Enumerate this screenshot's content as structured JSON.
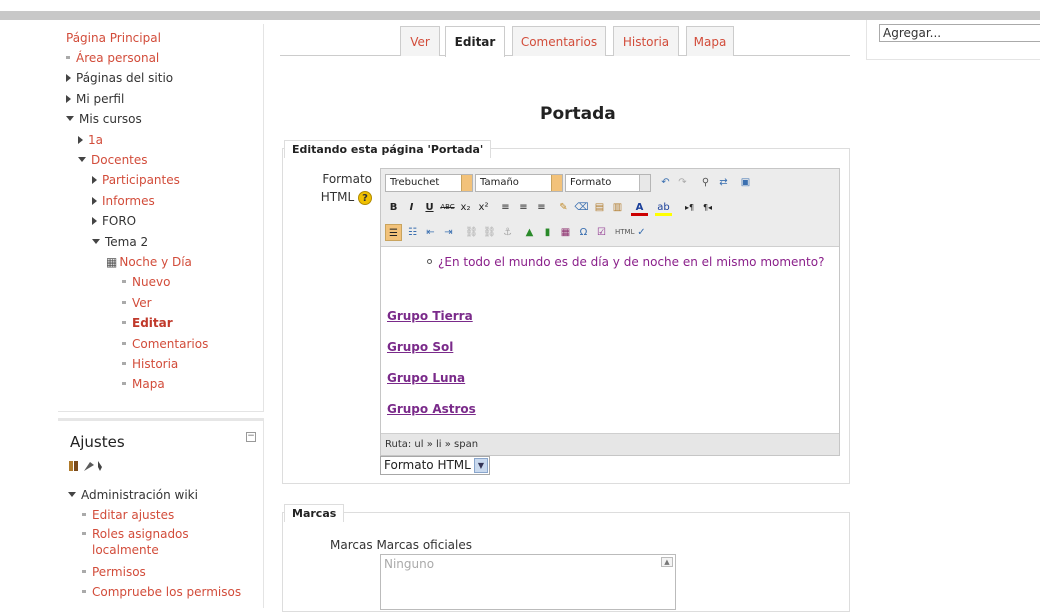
{
  "nav": {
    "home": "Página Principal",
    "items": [
      {
        "label": "Área personal",
        "type": "bullet",
        "indent": 0
      },
      {
        "label": "Páginas del sitio",
        "type": "collapsed",
        "indent": 0
      },
      {
        "label": "Mi perfil",
        "type": "collapsed",
        "indent": 0
      },
      {
        "label": "Mis cursos",
        "type": "expanded",
        "indent": 0
      },
      {
        "label": "1a",
        "type": "collapsed",
        "indent": 1
      },
      {
        "label": "Docentes",
        "type": "expanded",
        "indent": 1
      },
      {
        "label": "Participantes",
        "type": "collapsed",
        "indent": 2
      },
      {
        "label": "Informes",
        "type": "collapsed",
        "indent": 2
      },
      {
        "label": "FORO",
        "type": "collapsed",
        "indent": 2
      },
      {
        "label": "Tema 2",
        "type": "expanded",
        "indent": 2
      },
      {
        "label": "Noche y Día",
        "type": "wiki",
        "indent": 3
      },
      {
        "label": "Nuevo",
        "type": "bullet",
        "indent": 4
      },
      {
        "label": "Ver",
        "type": "bullet",
        "indent": 4
      },
      {
        "label": "Editar",
        "type": "bullet-active",
        "indent": 4
      },
      {
        "label": "Comentarios",
        "type": "bullet",
        "indent": 4
      },
      {
        "label": "Historia",
        "type": "bullet",
        "indent": 4
      },
      {
        "label": "Mapa",
        "type": "bullet",
        "indent": 4
      }
    ]
  },
  "settings": {
    "title": "Ajustes",
    "collapse": "−",
    "admin": "Administración wiki",
    "items": [
      "Editar ajustes",
      "Roles asignados localmente",
      "Permisos",
      "Compruebe los permisos"
    ]
  },
  "tabs": [
    "Ver",
    "Editar",
    "Comentarios",
    "Historia",
    "Mapa"
  ],
  "page_title": "Portada",
  "edit_section": {
    "legend": "Editando esta página 'Portada'",
    "format_label_1": "Formato",
    "format_label_2": "HTML",
    "help": "?"
  },
  "editor": {
    "font": "Trebuchet",
    "size": "Tamaño",
    "format": "Formato",
    "list_item": "¿En todo el mundo es de día y de noche en el mismo momento?",
    "groups": [
      "Grupo Tierra",
      "Grupo Sol",
      "Grupo Luna",
      "Grupo Astros"
    ],
    "path": "Ruta: ul » li » span",
    "format_select": "Formato HTML"
  },
  "tags": {
    "legend": "Marcas",
    "label": "Marcas Marcas oficiales",
    "textarea_value": "Ninguno"
  },
  "right": {
    "add_block": "Agregar..."
  },
  "colors": {
    "link": "#d24c3a",
    "visited": "#7a2a8a",
    "help": "#f0c000"
  }
}
